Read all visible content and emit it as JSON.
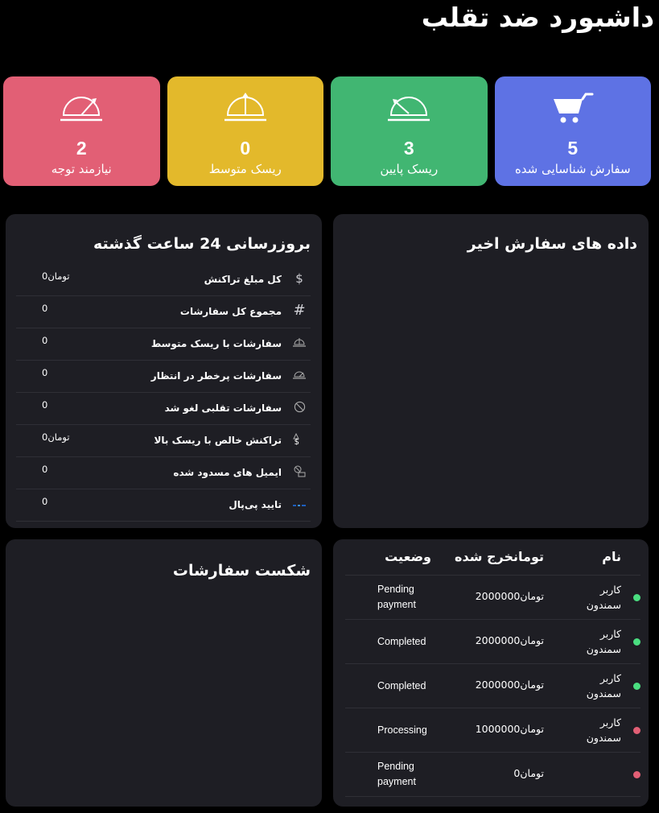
{
  "header": {
    "title": "داشبورد ضد تقلب"
  },
  "colors": {
    "identified": "#5e72e4",
    "low_risk": "#41b672",
    "medium_risk": "#e3b92b",
    "attention": "#e25f75",
    "dot_green": "#4ade80",
    "dot_red": "#e25f75"
  },
  "cards": [
    {
      "icon": "shopping-cart-icon",
      "count": "5",
      "label": "سفارش شناسایی شده",
      "color": "#5e72e4"
    },
    {
      "icon": "low-gauge-icon",
      "count": "3",
      "label": "ریسک پایین",
      "color": "#41b672"
    },
    {
      "icon": "medium-gauge-icon",
      "count": "0",
      "label": "ریسک متوسط",
      "color": "#e3b92b"
    },
    {
      "icon": "high-gauge-icon",
      "count": "2",
      "label": "نیازمند توجه",
      "color": "#e25f75"
    }
  ],
  "updates_24h": {
    "title": "بروزرسانی 24 ساعت گذشته",
    "rows": [
      {
        "icon": "dollar-icon",
        "label": "کل مبلغ تراکنش",
        "value": "تومان0"
      },
      {
        "icon": "hash-icon",
        "label": "مجموع کل سفارشات",
        "value": "0"
      },
      {
        "icon": "medium-gauge-icon",
        "label": "سفارشات با ریسک متوسط",
        "value": "0"
      },
      {
        "icon": "high-gauge-icon",
        "label": "سفارشات پرخطر در انتظار",
        "value": "0"
      },
      {
        "icon": "ban-icon",
        "label": "سفارشات تقلبی لغو شد",
        "value": "0"
      },
      {
        "icon": "warning-dollar-icon",
        "label": "تراکنش خالص با ریسک بالا",
        "value": "تومان0"
      },
      {
        "icon": "blocked-email-icon",
        "label": "ایمیل های مسدود شده",
        "value": "0"
      },
      {
        "icon": "paypal-icon",
        "label": "تایید پی‌پال",
        "value": "0"
      }
    ]
  },
  "recent_orders": {
    "title": "داده های سفارش اخیر"
  },
  "order_breakdown": {
    "title": "شکست سفارشات"
  },
  "orders_table": {
    "columns": {
      "name": "نام",
      "amount": "تومانخرج شده",
      "status": "وضعیت"
    },
    "rows": [
      {
        "dot": "green",
        "name": "کاربر سمندون",
        "amount": "تومان2000000",
        "status": "Pending payment"
      },
      {
        "dot": "green",
        "name": "کاربر سمندون",
        "amount": "تومان2000000",
        "status": "Completed"
      },
      {
        "dot": "green",
        "name": "کاربر سمندون",
        "amount": "تومان2000000",
        "status": "Completed"
      },
      {
        "dot": "red",
        "name": "کاربر سمندون",
        "amount": "تومان1000000",
        "status": "Processing"
      },
      {
        "dot": "red",
        "name": "",
        "amount": "تومان0",
        "status": "Pending payment"
      }
    ]
  }
}
